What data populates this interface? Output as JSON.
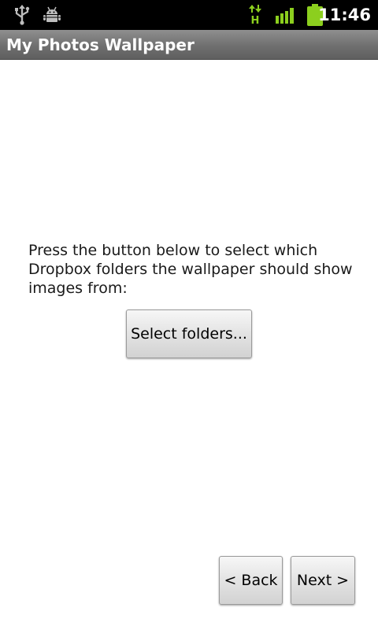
{
  "status_bar": {
    "time": "11:46",
    "network_type": "H",
    "icons": [
      "usb-icon",
      "android-debug-icon",
      "data-transfer-icon",
      "signal-icon",
      "battery-icon"
    ]
  },
  "app": {
    "title": "My Photos Wallpaper"
  },
  "main": {
    "instructions": "Press the button below to select which Dropbox folders the wallpaper should show images from:",
    "select_folders_label": "Select folders..."
  },
  "navigation": {
    "back_label": "< Back",
    "next_label": "Next >"
  },
  "colors": {
    "status_icon_green": "#8ccf1e",
    "status_icon_gray": "#bdbdbd",
    "title_bar": "#6f6f6f"
  }
}
